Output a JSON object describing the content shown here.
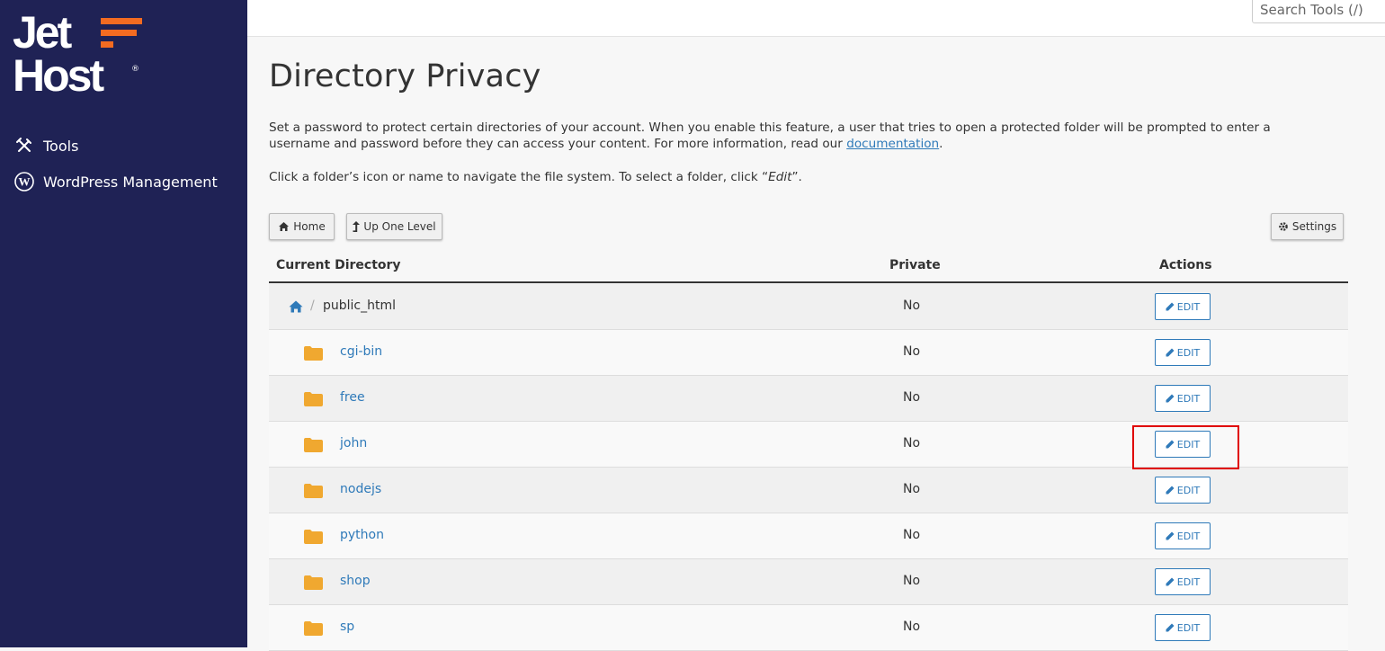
{
  "brand": {
    "line1": "Jet",
    "line2": "Host",
    "mark": "®",
    "accent_color": "#f36b21",
    "sidebar_color": "#1f2255"
  },
  "sidebar": {
    "items": [
      {
        "label": "Tools",
        "icon": "tools-icon"
      },
      {
        "label": "WordPress Management",
        "icon": "wordpress-icon"
      }
    ]
  },
  "search": {
    "placeholder": "Search Tools (/)"
  },
  "page": {
    "title": "Directory Privacy",
    "description_before_link": "Set a password to protect certain directories of your account. When you enable this feature, a user that tries to open a protected folder will be prompted to enter a username and password before they can access your content. For more information, read our ",
    "description_link": "documentation",
    "description_after_link": ".",
    "hint_before": "Click a folder’s icon or name to navigate the file system. To select a folder, click “",
    "hint_em": "Edit",
    "hint_after": "”."
  },
  "toolbar": {
    "home_label": "Home",
    "up_label": "Up One Level",
    "settings_label": "Settings"
  },
  "table": {
    "headers": {
      "directory": "Current Directory",
      "private": "Private",
      "actions": "Actions"
    },
    "current": {
      "name": "public_html",
      "private": "No",
      "action": "EDIT"
    },
    "rows": [
      {
        "name": "cgi-bin",
        "private": "No",
        "action": "EDIT"
      },
      {
        "name": "free",
        "private": "No",
        "action": "EDIT"
      },
      {
        "name": "john",
        "private": "No",
        "action": "EDIT"
      },
      {
        "name": "nodejs",
        "private": "No",
        "action": "EDIT"
      },
      {
        "name": "python",
        "private": "No",
        "action": "EDIT"
      },
      {
        "name": "shop",
        "private": "No",
        "action": "EDIT"
      },
      {
        "name": "sp",
        "private": "No",
        "action": "EDIT"
      }
    ]
  }
}
